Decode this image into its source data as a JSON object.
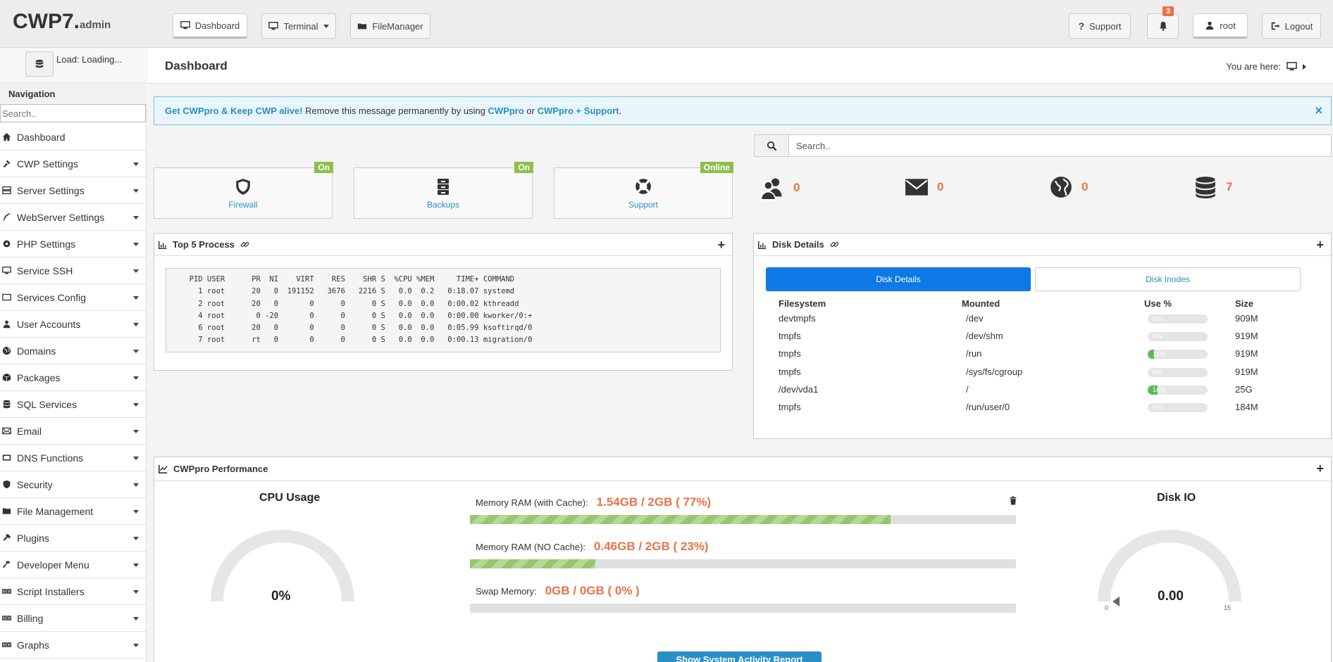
{
  "topbar": {
    "logo_main": "CWP7.",
    "logo_sub": "admin",
    "buttons": {
      "dashboard": "Dashboard",
      "terminal": "Terminal",
      "filemanager": "FileManager"
    },
    "support": "Support",
    "notifications_count": "3",
    "user": "root",
    "logout": "Logout"
  },
  "sidebar": {
    "load_text": "Load: Loading...",
    "nav_title": "Navigation",
    "search_placeholder": "Search..",
    "items": [
      {
        "label": "Dashboard",
        "icon": "home-icon",
        "dropdown": false
      },
      {
        "label": "CWP Settings",
        "icon": "tools-icon",
        "dropdown": true
      },
      {
        "label": "Server Settings",
        "icon": "server-icon",
        "dropdown": true
      },
      {
        "label": "WebServer Settings",
        "icon": "feather-icon",
        "dropdown": true
      },
      {
        "label": "PHP Settings",
        "icon": "gear-icon",
        "dropdown": true
      },
      {
        "label": "Service SSH",
        "icon": "monitor-icon",
        "dropdown": true
      },
      {
        "label": "Services Config",
        "icon": "box-icon",
        "dropdown": true
      },
      {
        "label": "User Accounts",
        "icon": "user-icon",
        "dropdown": true
      },
      {
        "label": "Domains",
        "icon": "globe-icon",
        "dropdown": true
      },
      {
        "label": "Packages",
        "icon": "packages-icon",
        "dropdown": true
      },
      {
        "label": "SQL Services",
        "icon": "database-icon",
        "dropdown": true
      },
      {
        "label": "Email",
        "icon": "envelope-icon",
        "dropdown": true
      },
      {
        "label": "DNS Functions",
        "icon": "dns-icon",
        "dropdown": true
      },
      {
        "label": "Security",
        "icon": "shield-icon",
        "dropdown": true
      },
      {
        "label": "File Management",
        "icon": "folder-icon",
        "dropdown": true
      },
      {
        "label": "Plugins",
        "icon": "plug-icon",
        "dropdown": true
      },
      {
        "label": "Developer Menu",
        "icon": "hammer-icon",
        "dropdown": true
      },
      {
        "label": "Script Installers",
        "icon": "new-badge-icon",
        "dropdown": true
      },
      {
        "label": "Billing",
        "icon": "new-badge-icon",
        "dropdown": true
      },
      {
        "label": "Graphs",
        "icon": "new-badge-icon",
        "dropdown": true
      }
    ]
  },
  "header": {
    "title": "Dashboard",
    "you_are_here": "You are here:"
  },
  "alert": {
    "part1": "Get CWPpro & Keep CWP alive!",
    "part2": " Remove this message permanently by using ",
    "part3": "CWPpro",
    "part4": " or ",
    "part5": "CWPpro + Support",
    "part6": ".",
    "close": "×"
  },
  "status_boxes": [
    {
      "label": "Firewall",
      "badge": "On",
      "icon": "shield-icon"
    },
    {
      "label": "Backups",
      "badge": "On",
      "icon": "archive-icon"
    },
    {
      "label": "Support",
      "badge": "Online",
      "icon": "lifebuoy-icon"
    }
  ],
  "right_search": {
    "placeholder": "Search.."
  },
  "stats": [
    {
      "icon": "users-icon",
      "value": "0"
    },
    {
      "icon": "envelope-icon",
      "value": "0"
    },
    {
      "icon": "globe-icon",
      "value": "0"
    },
    {
      "icon": "database-icon",
      "value": "7"
    }
  ],
  "top_process": {
    "title": "Top 5 Process",
    "text": "  PID USER      PR  NI    VIRT    RES    SHR S  %CPU %MEM     TIME+ COMMAND\n    1 root      20   0  191152   3676   2216 S   0.0  0.2   0:18.07 systemd\n    2 root      20   0       0      0      0 S   0.0  0.0   0:00.02 kthreadd\n    4 root       0 -20       0      0      0 S   0.0  0.0   0:00.00 kworker/0:+\n    6 root      20   0       0      0      0 S   0.0  0.0   0:05.99 ksoftirqd/0\n    7 root      rt   0       0      0      0 S   0.0  0.0   0:00.13 migration/0"
  },
  "disk_details": {
    "title": "Disk Details",
    "tabs": [
      "Disk Details",
      "Disk Inodes"
    ],
    "headers": [
      "Filesystem",
      "Mounted",
      "Use %",
      "Size"
    ],
    "rows": [
      {
        "fs": "devtmpfs",
        "mounted": "/dev",
        "use": "0%",
        "use_value": 0,
        "size": "909M"
      },
      {
        "fs": "tmpfs",
        "mounted": "/dev/shm",
        "use": "0%",
        "use_value": 0,
        "size": "919M"
      },
      {
        "fs": "tmpfs",
        "mounted": "/run",
        "use": "11%",
        "use_value": 11,
        "size": "919M"
      },
      {
        "fs": "tmpfs",
        "mounted": "/sys/fs/cgroup",
        "use": "0%",
        "use_value": 0,
        "size": "919M"
      },
      {
        "fs": "/dev/vda1",
        "mounted": "/",
        "use": "16%",
        "use_value": 16,
        "size": "25G"
      },
      {
        "fs": "tmpfs",
        "mounted": "/run/user/0",
        "use": "0%",
        "use_value": 0,
        "size": "184M"
      }
    ]
  },
  "performance": {
    "title": "CWPpro Performance",
    "cpu_title": "CPU Usage",
    "cpu_value": "0%",
    "mem_cache_label": "Memory RAM (with Cache):",
    "mem_cache_value": "1.54GB / 2GB ( 77%)",
    "mem_cache_pct": 77,
    "mem_nocache_label": "Memory RAM (NO Cache):",
    "mem_nocache_value": "0.46GB / 2GB ( 23%)",
    "mem_nocache_pct": 23,
    "swap_label": "Swap Memory:",
    "swap_value": "0GB / 0GB ( 0% )",
    "swap_pct": 0,
    "disk_io_title": "Disk IO",
    "disk_io_value": "0.00",
    "disk_io_min": "0",
    "disk_io_max": "15",
    "activity_button": "Show System Activity Report"
  },
  "colors": {
    "accent": "#e8734a",
    "link": "#2b8fc6",
    "badge": "#8cc04b",
    "tab_active": "#0d7ae6"
  }
}
